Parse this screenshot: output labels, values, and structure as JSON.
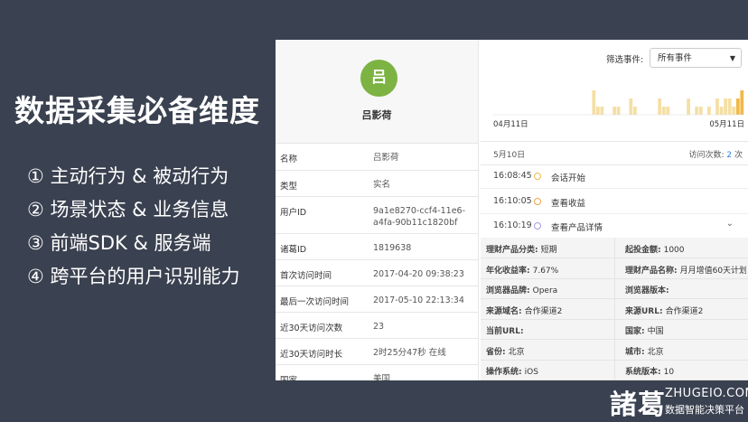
{
  "slide": {
    "title": "数据采集必备维度",
    "points": [
      "① 主动行为 & 被动行为",
      "② 场景状态 & 业务信息",
      "③ 前端SDK & 服务端",
      "④ 跨平台的用户识别能力"
    ]
  },
  "profile": {
    "avatar_char": "吕",
    "avatar_color": "#7cb342",
    "name": "吕影荷"
  },
  "attributes": [
    {
      "key": "名称",
      "value": "吕影荷"
    },
    {
      "key": "类型",
      "value": "实名"
    },
    {
      "key": "用户ID",
      "value": "9a1e8270-ccf4-11e6-a4fa-90b11c1820bf"
    },
    {
      "key": "诸葛ID",
      "value": "1819638"
    },
    {
      "key": "首次访问时间",
      "value": "2017-04-20 09:38:23"
    },
    {
      "key": "最后一次访问时间",
      "value": "2017-05-10 22:13:34"
    },
    {
      "key": "近30天访问次数",
      "value": "23"
    },
    {
      "key": "近30天访问时长",
      "value": "2时25分47秒 在线"
    },
    {
      "key": "国家",
      "value": "美国"
    }
  ],
  "filter": {
    "label": "筛选事件:",
    "selected": "所有事件",
    "caret_icon": "triangle-down-icon"
  },
  "activity_chart": {
    "start_label": "04月11日",
    "end_label": "05月11日",
    "values": [
      0,
      0,
      0,
      0,
      0,
      0,
      0,
      0,
      0,
      0,
      0,
      0,
      0,
      0,
      0,
      0,
      0,
      0,
      0,
      0,
      0,
      0,
      0,
      0,
      3,
      1,
      1,
      0,
      0,
      1,
      1,
      0,
      0,
      2,
      1,
      0,
      0,
      0,
      0,
      0,
      2,
      1,
      1,
      0,
      0,
      0,
      0,
      2,
      0,
      1,
      1,
      0,
      1,
      0,
      2,
      1,
      2,
      2,
      1,
      2,
      3
    ],
    "highlight_last": 2,
    "bar_color": "#f5dfa5",
    "highlight_color": "#f1b84a"
  },
  "session": {
    "date": "5月10日",
    "count_label": "访问次数:",
    "count_value": "2",
    "count_unit": "次"
  },
  "events": [
    {
      "time": "16:08:45",
      "name": "会话开始",
      "dot_color": "#f1b84a"
    },
    {
      "time": "16:10:05",
      "name": "查看收益",
      "dot_color": "#f1a04a"
    },
    {
      "time": "16:10:19",
      "name": "查看产品详情",
      "dot_color": "#a39be0",
      "expand_icon": "chevron-down-icon"
    }
  ],
  "details": [
    [
      {
        "key": "理财产品分类:",
        "value": "短期"
      },
      {
        "key": "起投金额:",
        "value": "1000"
      }
    ],
    [
      {
        "key": "年化收益率:",
        "value": "7.67%"
      },
      {
        "key": "理财产品名称:",
        "value": "月月增值60天计划"
      }
    ],
    [
      {
        "key": "浏览器品牌:",
        "value": "Opera"
      },
      {
        "key": "浏览器版本:",
        "value": ""
      }
    ],
    [
      {
        "key": "来源域名:",
        "value": "合作渠道2"
      },
      {
        "key": "来源URL:",
        "value": "合作渠道2"
      }
    ],
    [
      {
        "key": "当前URL:",
        "value": ""
      },
      {
        "key": "国家:",
        "value": "中国"
      }
    ],
    [
      {
        "key": "省份:",
        "value": "北京"
      },
      {
        "key": "城市:",
        "value": "北京"
      }
    ],
    [
      {
        "key": "操作系统:",
        "value": "iOS"
      },
      {
        "key": "系统版本:",
        "value": "10"
      }
    ]
  ],
  "brand": {
    "logo": "諸葛",
    "url": "ZHUGEIO.COM",
    "tagline": "数据智能决策平台"
  }
}
